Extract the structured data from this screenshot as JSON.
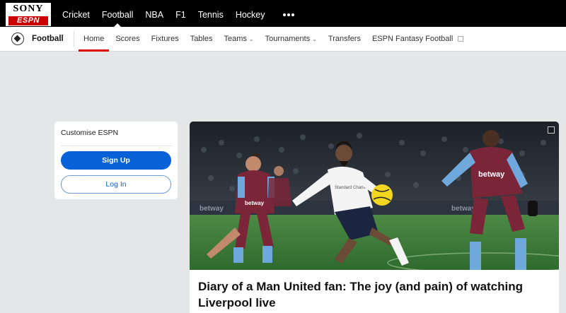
{
  "brand": {
    "top": "SONY",
    "bottom": "ESPN"
  },
  "top_nav": [
    {
      "label": "Cricket",
      "active": false
    },
    {
      "label": "Football",
      "active": true
    },
    {
      "label": "NBA",
      "active": false
    },
    {
      "label": "F1",
      "active": false
    },
    {
      "label": "Tennis",
      "active": false
    },
    {
      "label": "Hockey",
      "active": false
    }
  ],
  "sub_nav": {
    "sport_title": "Football",
    "items": [
      {
        "label": "Home",
        "active": true
      },
      {
        "label": "Scores"
      },
      {
        "label": "Fixtures"
      },
      {
        "label": "Tables"
      },
      {
        "label": "Teams",
        "dropdown": true
      },
      {
        "label": "Tournaments",
        "dropdown": true
      },
      {
        "label": "Transfers"
      },
      {
        "label": "ESPN Fantasy Football",
        "external": true
      }
    ]
  },
  "customise": {
    "title": "Customise ESPN",
    "signup_label": "Sign Up",
    "login_label": "Log In"
  },
  "story": {
    "headline": "Diary of a Man United fan: The joy (and pain) of watching Liverpool live",
    "sponsor_left": "betway",
    "sponsor_right": "betway",
    "sponsor_center": "Standard Chartered"
  },
  "colors": {
    "accent_red": "#dd0000",
    "primary_blue": "#0861d6",
    "west_ham_claret": "#7a2638",
    "west_ham_blue": "#6fa8dc",
    "pitch_green": "#3f7a3a"
  }
}
